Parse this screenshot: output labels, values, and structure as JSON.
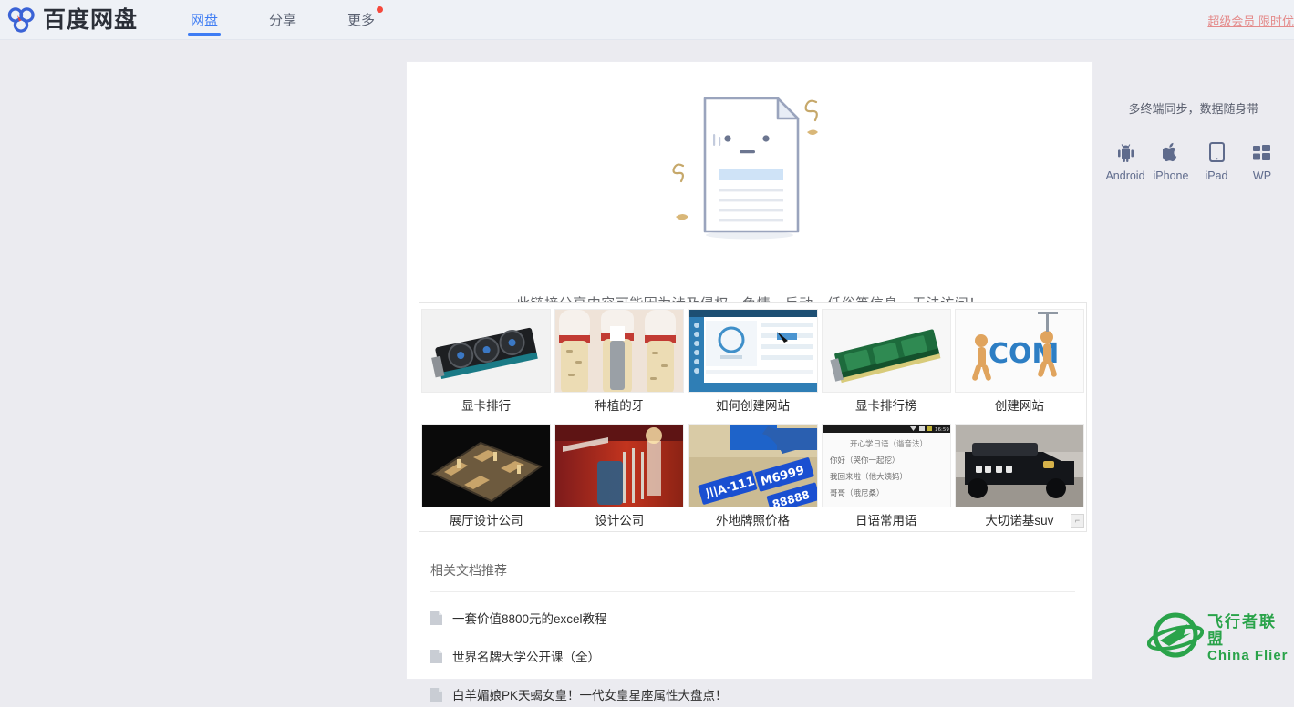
{
  "header": {
    "logo_text": "百度网盘",
    "logo_icon": "baidu-cloud-logo",
    "nav": [
      {
        "label": "网盘",
        "active": true
      },
      {
        "label": "分享",
        "active": false
      },
      {
        "label": "更多",
        "active": false,
        "badge": true
      }
    ],
    "vip_link": "超级会员 限时优"
  },
  "main": {
    "illustration": "sad-document-illustration",
    "blocked_message": "此链接分享内容可能因为涉及侵权、色情、反动、低俗等信息，无法访问！",
    "grid": {
      "rows": [
        [
          {
            "label": "显卡排行",
            "thumb": "graphics-card-thumb"
          },
          {
            "label": "种植的牙",
            "thumb": "dental-implant-thumb"
          },
          {
            "label": "如何创建网站",
            "thumb": "website-builder-screenshot-thumb"
          },
          {
            "label": "显卡排行榜",
            "thumb": "green-graphics-card-thumb"
          },
          {
            "label": "创建网站",
            "thumb": "com-letters-3d-thumb"
          }
        ],
        [
          {
            "label": "展厅设计公司",
            "thumb": "interior-floorplan-model-thumb"
          },
          {
            "label": "设计公司",
            "thumb": "red-exhibition-hall-thumb"
          },
          {
            "label": "外地牌照价格",
            "thumb": "license-plates-thumb"
          },
          {
            "label": "日语常用语",
            "thumb": "japanese-phrases-screenshot-thumb"
          },
          {
            "label": "大切诺基suv",
            "thumb": "jeep-suv-thumb"
          }
        ]
      ],
      "corner_handle": "⌐",
      "japanese_thumb_lines": [
        "开心学日语（谐音法）",
        "你好（哭你一起挖）",
        "我回来啦（他大姨妈）",
        "哥哥（哦尼桑）"
      ],
      "japanese_thumb_status_time": "16:59"
    },
    "docs": {
      "title": "相关文档推荐",
      "items": [
        {
          "label": "一套价值8800元的excel教程"
        },
        {
          "label": "世界名牌大学公开课（全）"
        },
        {
          "label": "白羊媚娘PK天蝎女皇！一代女皇星座属性大盘点！"
        }
      ]
    }
  },
  "sidebar": {
    "title": "多终端同步，数据随身带",
    "apps": [
      {
        "name": "Android",
        "icon": "android-icon"
      },
      {
        "name": "iPhone",
        "icon": "apple-icon"
      },
      {
        "name": "iPad",
        "icon": "ipad-icon"
      },
      {
        "name": "WP",
        "icon": "windows-phone-icon"
      }
    ]
  },
  "watermark": {
    "icon": "china-flier-globe-plane-logo",
    "cn": "飞行者联盟",
    "en": "China Flier",
    "color": "#2aa34a"
  },
  "colors": {
    "page_bg": "#ebebf0",
    "topbar_bg": "#eef1f6",
    "accent_blue": "#3d7cf4",
    "badge_red": "#f5483b",
    "card_bg": "#ffffff"
  }
}
